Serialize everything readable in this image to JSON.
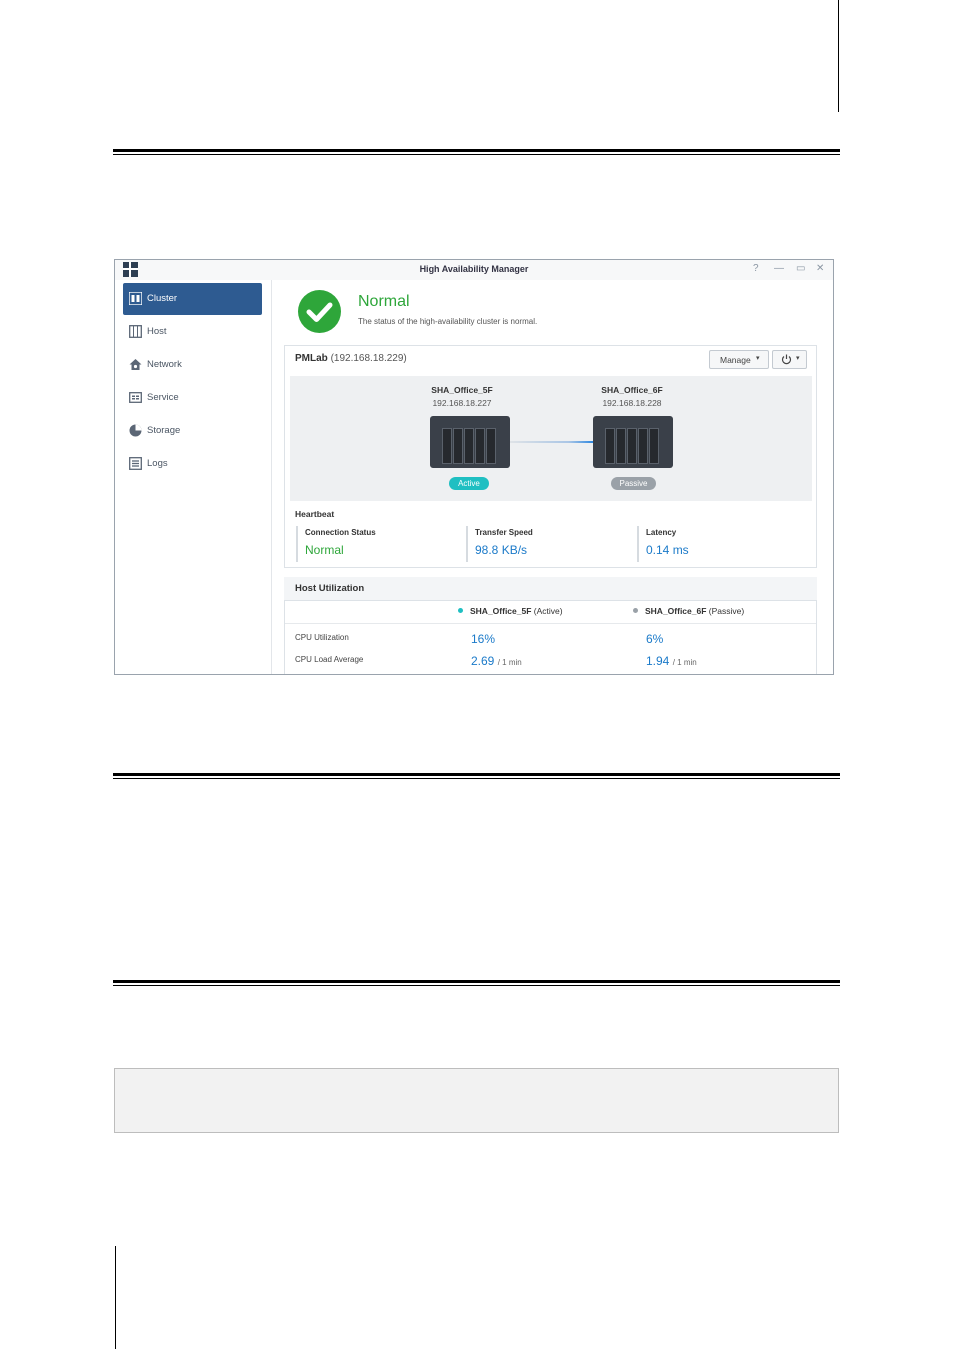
{
  "window": {
    "title": "High Availability Manager",
    "controls": {
      "help": "?",
      "minimize": "—",
      "maximize": "▭",
      "close": "✕"
    }
  },
  "sidebar": {
    "items": [
      {
        "label": "Cluster",
        "icon": "cluster-icon",
        "active": true
      },
      {
        "label": "Host",
        "icon": "host-icon"
      },
      {
        "label": "Network",
        "icon": "network-icon"
      },
      {
        "label": "Service",
        "icon": "service-icon"
      },
      {
        "label": "Storage",
        "icon": "storage-icon"
      },
      {
        "label": "Logs",
        "icon": "logs-icon"
      }
    ]
  },
  "status": {
    "title": "Normal",
    "description": "The status of the high-availability cluster is normal.",
    "color": "#2ea63a"
  },
  "cluster": {
    "name": "PMLab",
    "ip": "(192.168.18.229)",
    "manage_label": "Manage",
    "power_icon": "power-icon",
    "nodes": [
      {
        "name": "SHA_Office_5F",
        "ip": "192.168.18.227",
        "role": "Active",
        "role_color": "#1fbfc2"
      },
      {
        "name": "SHA_Office_6F",
        "ip": "192.168.18.228",
        "role": "Passive",
        "role_color": "#9aa1a8"
      }
    ]
  },
  "heartbeat": {
    "title": "Heartbeat",
    "columns": [
      {
        "label": "Connection Status",
        "value": "Normal",
        "color": "#2ea63a"
      },
      {
        "label": "Transfer Speed",
        "value": "98.8 KB/s",
        "color": "#1b7ac9"
      },
      {
        "label": "Latency",
        "value": "0.14 ms",
        "color": "#1b7ac9"
      }
    ]
  },
  "utilization": {
    "title": "Host Utilization",
    "hosts": [
      {
        "name": "SHA_Office_5F",
        "role": "(Active)",
        "dot_color": "#1fbfc2"
      },
      {
        "name": "SHA_Office_6F",
        "role": "(Passive)",
        "dot_color": "#9aa1a8"
      }
    ],
    "rows": [
      {
        "label": "CPU Utilization",
        "values": [
          "16%",
          "6%"
        ],
        "unit": ""
      },
      {
        "label": "CPU Load Average",
        "values": [
          "2.69",
          "1.94"
        ],
        "unit": "/ 1 min"
      }
    ]
  }
}
